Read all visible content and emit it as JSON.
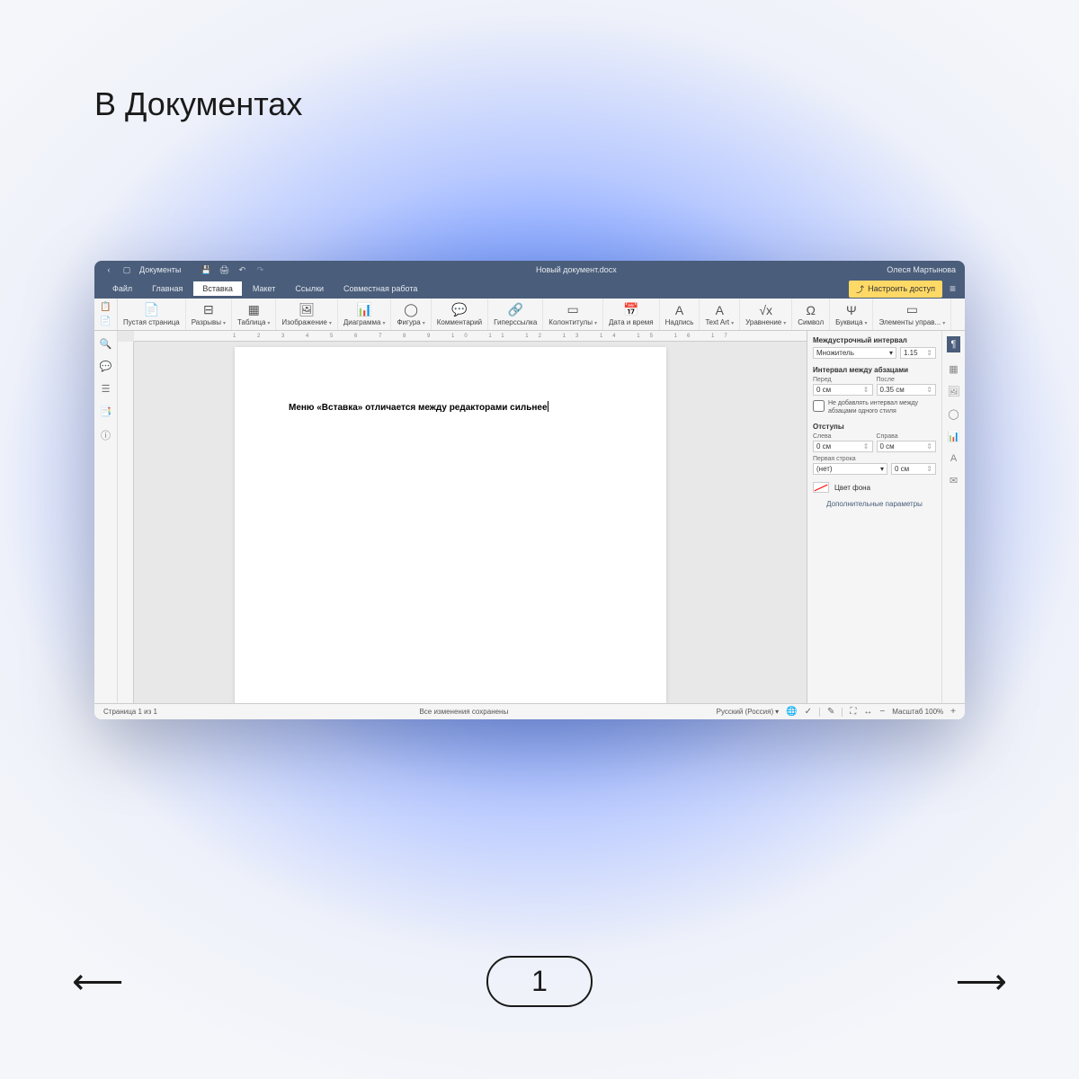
{
  "page": {
    "title": "В Документах",
    "indicator": "1"
  },
  "titlebar": {
    "app_name": "Документы",
    "doc_name": "Новый документ.docx",
    "user_name": "Олеся Мартынова"
  },
  "menu": {
    "tabs": [
      "Файл",
      "Главная",
      "Вставка",
      "Макет",
      "Ссылки",
      "Совместная работа"
    ],
    "active_index": 2,
    "access_button": "Настроить доступ"
  },
  "ribbon": {
    "items": [
      {
        "icon": "📄",
        "label": "Пустая страница",
        "dropdown": false
      },
      {
        "icon": "⊟",
        "label": "Разрывы",
        "dropdown": true
      },
      {
        "icon": "▦",
        "label": "Таблица",
        "dropdown": true
      },
      {
        "icon": "🖼",
        "label": "Изображение",
        "dropdown": true
      },
      {
        "icon": "📊",
        "label": "Диаграмма",
        "dropdown": true
      },
      {
        "icon": "◯",
        "label": "Фигура",
        "dropdown": true
      },
      {
        "icon": "💬",
        "label": "Комментарий",
        "dropdown": false
      },
      {
        "icon": "🔗",
        "label": "Гиперссылка",
        "dropdown": false
      },
      {
        "icon": "▭",
        "label": "Колонтитулы",
        "dropdown": true
      },
      {
        "icon": "📅",
        "label": "Дата и время",
        "dropdown": false
      },
      {
        "icon": "A",
        "label": "Надпись",
        "dropdown": false
      },
      {
        "icon": "A",
        "label": "Text Art",
        "dropdown": true
      },
      {
        "icon": "√x",
        "label": "Уравнение",
        "dropdown": true
      },
      {
        "icon": "Ω",
        "label": "Символ",
        "dropdown": false
      },
      {
        "icon": "Ψ",
        "label": "Буквица",
        "dropdown": true
      },
      {
        "icon": "▭",
        "label": "Элементы управ...",
        "dropdown": true
      }
    ]
  },
  "document": {
    "text": "Меню «Вставка» отличается между редакторами сильнее"
  },
  "right_panel": {
    "line_spacing": {
      "title": "Междустрочный интервал",
      "mode": "Множитель",
      "value": "1.15"
    },
    "para_spacing": {
      "title": "Интервал между абзацами",
      "before_label": "Перед",
      "before_value": "0 см",
      "after_label": "После",
      "after_value": "0.35 см",
      "checkbox_label": "Не добавлять интервал между абзацами одного стиля"
    },
    "indents": {
      "title": "Отступы",
      "left_label": "Слева",
      "left_value": "0 см",
      "right_label": "Справа",
      "right_value": "0 см",
      "first_line_label": "Первая строка",
      "first_line_mode": "(нет)",
      "first_line_value": "0 см"
    },
    "bg_color_label": "Цвет фона",
    "advanced_link": "Дополнительные параметры"
  },
  "statusbar": {
    "page_info": "Страница 1 из 1",
    "save_status": "Все изменения сохранены",
    "language": "Русский (Россия)",
    "zoom_label": "Масштаб 100%"
  }
}
